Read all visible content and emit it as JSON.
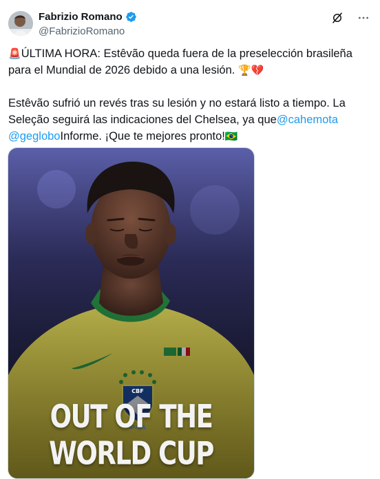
{
  "author": {
    "name": "Fabrizio Romano",
    "handle": "@FabrizioRomano",
    "avatar_icon": "avatar-photo",
    "verified_color": "#1d9bf0"
  },
  "actions": {
    "grok_icon": "grok-icon",
    "more_icon": "more-dots-icon"
  },
  "tweet": {
    "p1_emoji_lead": "🚨",
    "p1_text": "ÚLTIMA HORA: Estêvão queda fuera de la preselección brasileña para el Mundial de 2026 debido a una lesión.",
    "p1_emoji_trail": "🏆💔",
    "p2_text": "Estêvão sufrió un revés tras su lesión y no estará listo a tiempo. La Seleção seguirá las indicaciones del Chelsea, ya que",
    "mention1": "@cahemota",
    "mention2": "@geglobo",
    "p2_tail": "Informe. ¡Que te mejores pronto!",
    "p2_flag": "🇧🇷"
  },
  "media": {
    "overlay_text": "OUT OF THE WORLD CUP",
    "crest_label": "CBF",
    "crest_sub": "BRASIL"
  },
  "colors": {
    "link": "#1d9bf0",
    "jersey_yellow": "#f2e34a",
    "collar_green": "#2c9a4a"
  }
}
